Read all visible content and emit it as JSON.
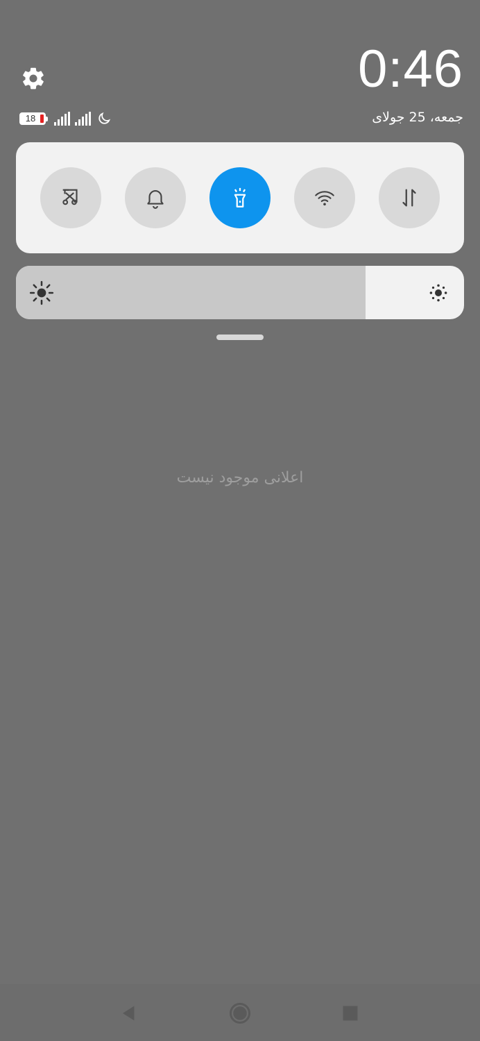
{
  "header": {
    "time": "0:46",
    "date": "جمعه، 25 جولای",
    "battery_level": "18",
    "settings_icon": "gear-icon"
  },
  "status_icons": [
    "battery-icon",
    "signal-1-icon",
    "signal-2-icon",
    "moon-icon"
  ],
  "quick_settings": {
    "tiles": [
      {
        "icon": "screenshot-scissors-icon",
        "active": false
      },
      {
        "icon": "bell-icon",
        "active": false
      },
      {
        "icon": "flashlight-icon",
        "active": true
      },
      {
        "icon": "wifi-icon",
        "active": false
      },
      {
        "icon": "mobile-data-icon",
        "active": false
      }
    ],
    "active_color": "#0e94ee"
  },
  "brightness": {
    "level": 0.78,
    "low_icon": "brightness-low-icon",
    "high_icon": "brightness-high-icon"
  },
  "notifications": {
    "empty_text": "اعلانی موجود نیست"
  },
  "navbar": {
    "buttons": [
      "back-icon",
      "home-icon",
      "recents-icon"
    ]
  },
  "colors": {
    "background": "#707070",
    "card": "#f2f2f2",
    "tile": "#d9d9d9"
  }
}
